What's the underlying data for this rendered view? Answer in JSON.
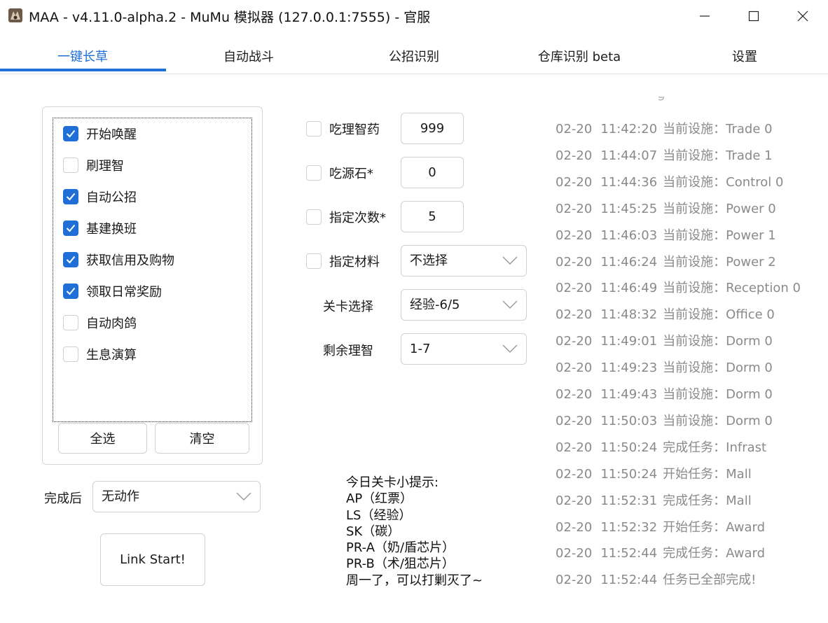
{
  "window": {
    "title": "MAA - v4.11.0-alpha.2 - MuMu 模拟器 (127.0.0.1:7555) - 官服"
  },
  "tabs": [
    {
      "label": "一键长草",
      "active": true
    },
    {
      "label": "自动战斗",
      "active": false
    },
    {
      "label": "公招识别",
      "active": false
    },
    {
      "label": "仓库识别 beta",
      "active": false
    },
    {
      "label": "设置",
      "active": false
    }
  ],
  "tasks": [
    {
      "label": "开始唤醒",
      "checked": true
    },
    {
      "label": "刷理智",
      "checked": false
    },
    {
      "label": "自动公招",
      "checked": true
    },
    {
      "label": "基建换班",
      "checked": true
    },
    {
      "label": "获取信用及购物",
      "checked": true
    },
    {
      "label": "领取日常奖励",
      "checked": true
    },
    {
      "label": "自动肉鸽",
      "checked": false
    },
    {
      "label": "生息演算",
      "checked": false
    }
  ],
  "task_buttons": {
    "select_all": "全选",
    "clear": "清空"
  },
  "after_complete": {
    "label": "完成后",
    "value": "无动作"
  },
  "link_start": "Link Start!",
  "options": {
    "medicine": {
      "label": "吃理智药",
      "checked": false,
      "value": "999"
    },
    "stone": {
      "label": "吃源石*",
      "checked": false,
      "value": "0"
    },
    "times": {
      "label": "指定次数*",
      "checked": false,
      "value": "5"
    },
    "material": {
      "label": "指定材料",
      "checked": false,
      "value": "不选择"
    },
    "stage": {
      "label": "关卡选择",
      "value": "经验-6/5"
    },
    "remaining": {
      "label": "剩余理智",
      "value": "1-7"
    }
  },
  "tips": [
    "今日关卡小提示:",
    "AP（红票）",
    "LS（经验）",
    "SK（碳）",
    "PR-A（奶/盾芯片）",
    "PR-B（术/狙芯片）",
    "周一了，可以打剿灭了~"
  ],
  "log_partial": "g",
  "log": [
    {
      "date": "02-20",
      "time": "11:42:20",
      "msg": "当前设施：Trade 0"
    },
    {
      "date": "02-20",
      "time": "11:44:07",
      "msg": "当前设施：Trade 1"
    },
    {
      "date": "02-20",
      "time": "11:44:36",
      "msg": "当前设施：Control 0"
    },
    {
      "date": "02-20",
      "time": "11:45:25",
      "msg": "当前设施：Power 0"
    },
    {
      "date": "02-20",
      "time": "11:46:03",
      "msg": "当前设施：Power 1"
    },
    {
      "date": "02-20",
      "time": "11:46:24",
      "msg": "当前设施：Power 2"
    },
    {
      "date": "02-20",
      "time": "11:46:49",
      "msg": "当前设施：Reception 0"
    },
    {
      "date": "02-20",
      "time": "11:48:32",
      "msg": "当前设施：Office 0"
    },
    {
      "date": "02-20",
      "time": "11:49:01",
      "msg": "当前设施：Dorm 0"
    },
    {
      "date": "02-20",
      "time": "11:49:23",
      "msg": "当前设施：Dorm 0"
    },
    {
      "date": "02-20",
      "time": "11:49:43",
      "msg": "当前设施：Dorm 0"
    },
    {
      "date": "02-20",
      "time": "11:50:03",
      "msg": "当前设施：Dorm 0"
    },
    {
      "date": "02-20",
      "time": "11:50:24",
      "msg": "完成任务：Infrast"
    },
    {
      "date": "02-20",
      "time": "11:50:24",
      "msg": "开始任务：Mall"
    },
    {
      "date": "02-20",
      "time": "11:52:31",
      "msg": "完成任务：Mall"
    },
    {
      "date": "02-20",
      "time": "11:52:32",
      "msg": "开始任务：Award"
    },
    {
      "date": "02-20",
      "time": "11:52:44",
      "msg": "完成任务：Award"
    },
    {
      "date": "02-20",
      "time": "11:52:44",
      "msg": "任务已全部完成!"
    }
  ],
  "colors": {
    "accent": "#1f6fd6",
    "log_text": "#8a8a8a"
  }
}
